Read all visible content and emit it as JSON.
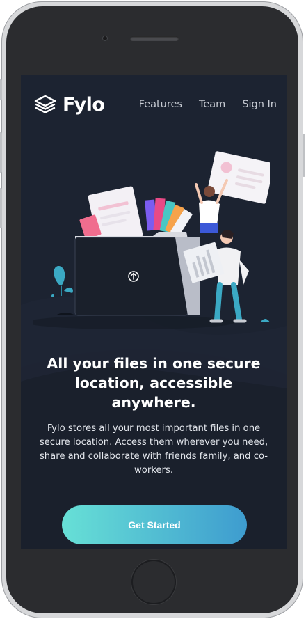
{
  "app": {
    "name": "Fylo",
    "logo_icon": "stacked-layers-icon"
  },
  "nav": {
    "items": [
      {
        "label": "Features"
      },
      {
        "label": "Team"
      },
      {
        "label": "Sign In"
      }
    ]
  },
  "hero": {
    "title": "All your files in one secure location, accessible anywhere.",
    "description": "Fylo stores all your most important files in one secure location. Access them wherever you need, share and collaborate with friends family, and co-workers.",
    "cta_label": "Get Started",
    "illustration_icons": [
      "folder-icon",
      "upload-arrow-icon",
      "document-icon",
      "person-icon",
      "plant-icon",
      "color-swatches-icon"
    ]
  },
  "colors": {
    "background": "#1c2331",
    "text": "#ffffff",
    "nav_text": "#c8ccd4",
    "cta_gradient_start": "#67e0d6",
    "cta_gradient_end": "#3e9ccf",
    "device_frame": "#2b2c2f"
  }
}
